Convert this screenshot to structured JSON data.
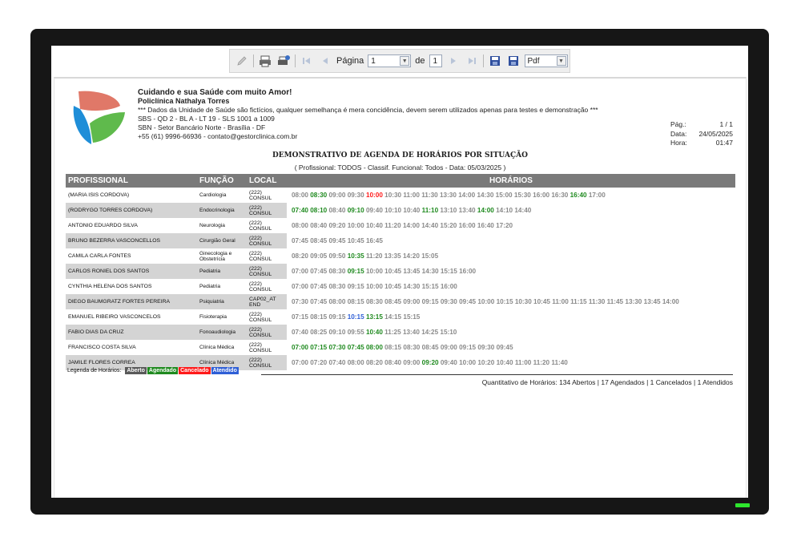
{
  "toolbar": {
    "page_label": "Página",
    "page_value": "1",
    "of_label": "de",
    "total_pages": "1",
    "format_value": "Pdf"
  },
  "header": {
    "slogan": "Cuidando e sua Saúde com muito Amor!",
    "clinic": "Policlínica Nathalya Torres",
    "disclaimer": "*** Dados da Unidade de Saúde são fictícios, qualquer semelhança é mera concidência, devem serem utilizados apenas para testes e demonstração ***",
    "address1": "SBS - QD 2 - BL A - LT 19 - SLS 1001 a 1009",
    "address2": "SBN - Setor Bancário Norte - Brasília - DF",
    "contact": "+55 (61) 9996-66936 - contato@gestorclinica.com.br"
  },
  "meta": {
    "page_label": "Pág.:",
    "page_value": "1 / 1",
    "date_label": "Data:",
    "date_value": "24/05/2025",
    "time_label": "Hora:",
    "time_value": "01:47"
  },
  "report": {
    "title": "DEMONSTRATIVO DE AGENDA DE HORÁRIOS POR SITUAÇÃO",
    "subtitle": "( Profissional: TODOS - Classif. Funcional: Todos - Data: 05/03/2025 )",
    "columns": [
      "PROFISSIONAL",
      "FUNÇÃO",
      "LOCAL",
      "HORÁRIOS"
    ],
    "rows": [
      {
        "name": "(MARIA ISIS CORDOVA)",
        "function": "Cardiologia",
        "local": "(222) CONSUL",
        "times": [
          [
            "08:00",
            "aberto"
          ],
          [
            "08:30",
            "agendado"
          ],
          [
            "09:00",
            "aberto"
          ],
          [
            "09:30",
            "aberto"
          ],
          [
            "10:00",
            "cancelado"
          ],
          [
            "10:30",
            "aberto"
          ],
          [
            "11:00",
            "aberto"
          ],
          [
            "11:30",
            "aberto"
          ],
          [
            "13:30",
            "aberto"
          ],
          [
            "14:00",
            "aberto"
          ],
          [
            "14:30",
            "aberto"
          ],
          [
            "15:00",
            "aberto"
          ],
          [
            "15:30",
            "aberto"
          ],
          [
            "16:00",
            "aberto"
          ],
          [
            "16:30",
            "aberto"
          ],
          [
            "16:40",
            "agendado"
          ],
          [
            "17:00",
            "aberto"
          ]
        ]
      },
      {
        "name": "(RODRYGO TORRES CORDOVA)",
        "function": "Endocrinologia",
        "local": "(222) CONSUL",
        "times": [
          [
            "07:40",
            "agendado"
          ],
          [
            "08:10",
            "agendado"
          ],
          [
            "08:40",
            "aberto"
          ],
          [
            "09:10",
            "agendado"
          ],
          [
            "09:40",
            "aberto"
          ],
          [
            "10:10",
            "aberto"
          ],
          [
            "10:40",
            "aberto"
          ],
          [
            "11:10",
            "agendado"
          ],
          [
            "13:10",
            "aberto"
          ],
          [
            "13:40",
            "aberto"
          ],
          [
            "14:00",
            "agendado"
          ],
          [
            "14:10",
            "aberto"
          ],
          [
            "14:40",
            "aberto"
          ]
        ]
      },
      {
        "name": "ANTONIO EDUARDO SILVA",
        "function": "Neurologia",
        "local": "(222) CONSUL",
        "times": [
          [
            "08:00",
            "aberto"
          ],
          [
            "08:40",
            "aberto"
          ],
          [
            "09:20",
            "aberto"
          ],
          [
            "10:00",
            "aberto"
          ],
          [
            "10:40",
            "aberto"
          ],
          [
            "11:20",
            "aberto"
          ],
          [
            "14:00",
            "aberto"
          ],
          [
            "14:40",
            "aberto"
          ],
          [
            "15:20",
            "aberto"
          ],
          [
            "16:00",
            "aberto"
          ],
          [
            "16:40",
            "aberto"
          ],
          [
            "17:20",
            "aberto"
          ]
        ]
      },
      {
        "name": "BRUNO BEZERRA VASCONCELLOS",
        "function": "Cirurgião Geral",
        "local": "(222) CONSUL",
        "times": [
          [
            "07:45",
            "aberto"
          ],
          [
            "08:45",
            "aberto"
          ],
          [
            "09:45",
            "aberto"
          ],
          [
            "10:45",
            "aberto"
          ],
          [
            "16:45",
            "aberto"
          ]
        ]
      },
      {
        "name": "CAMILA CARLA FONTES",
        "function": "Ginecologia e Obstetrícia",
        "local": "(222) CONSUL",
        "times": [
          [
            "08:20",
            "aberto"
          ],
          [
            "09:05",
            "aberto"
          ],
          [
            "09:50",
            "aberto"
          ],
          [
            "10:35",
            "agendado"
          ],
          [
            "11:20",
            "aberto"
          ],
          [
            "13:35",
            "aberto"
          ],
          [
            "14:20",
            "aberto"
          ],
          [
            "15:05",
            "aberto"
          ]
        ]
      },
      {
        "name": "CARLOS RONIEL DOS SANTOS",
        "function": "Pediatria",
        "local": "(222) CONSUL",
        "times": [
          [
            "07:00",
            "aberto"
          ],
          [
            "07:45",
            "aberto"
          ],
          [
            "08:30",
            "aberto"
          ],
          [
            "09:15",
            "agendado"
          ],
          [
            "10:00",
            "aberto"
          ],
          [
            "10:45",
            "aberto"
          ],
          [
            "13:45",
            "aberto"
          ],
          [
            "14:30",
            "aberto"
          ],
          [
            "15:15",
            "aberto"
          ],
          [
            "16:00",
            "aberto"
          ]
        ]
      },
      {
        "name": "CYNTHIA HELENA DOS SANTOS",
        "function": "Pediatria",
        "local": "(222) CONSUL",
        "times": [
          [
            "07:00",
            "aberto"
          ],
          [
            "07:45",
            "aberto"
          ],
          [
            "08:30",
            "aberto"
          ],
          [
            "09:15",
            "aberto"
          ],
          [
            "10:00",
            "aberto"
          ],
          [
            "10:45",
            "aberto"
          ],
          [
            "14:30",
            "aberto"
          ],
          [
            "15:15",
            "aberto"
          ],
          [
            "16:00",
            "aberto"
          ]
        ]
      },
      {
        "name": "DIEGO BAUMGRATZ FORTES PEREIRA",
        "function": "Psiquiatria",
        "local": "CAP02_AT END",
        "times": [
          [
            "07:30",
            "aberto"
          ],
          [
            "07:45",
            "aberto"
          ],
          [
            "08:00",
            "aberto"
          ],
          [
            "08:15",
            "aberto"
          ],
          [
            "08:30",
            "aberto"
          ],
          [
            "08:45",
            "aberto"
          ],
          [
            "09:00",
            "aberto"
          ],
          [
            "09:15",
            "aberto"
          ],
          [
            "09:30",
            "aberto"
          ],
          [
            "09:45",
            "aberto"
          ],
          [
            "10:00",
            "aberto"
          ],
          [
            "10:15",
            "aberto"
          ],
          [
            "10:30",
            "aberto"
          ],
          [
            "10:45",
            "aberto"
          ],
          [
            "11:00",
            "aberto"
          ],
          [
            "11:15",
            "aberto"
          ],
          [
            "11:30",
            "aberto"
          ],
          [
            "11:45",
            "aberto"
          ],
          [
            "13:30",
            "aberto"
          ],
          [
            "13:45",
            "aberto"
          ],
          [
            "14:00",
            "aberto"
          ]
        ]
      },
      {
        "name": "EMANUEL RIBEIRO VASCONCELOS",
        "function": "Fisioterapia",
        "local": "(222) CONSUL",
        "times": [
          [
            "07:15",
            "aberto"
          ],
          [
            "08:15",
            "aberto"
          ],
          [
            "09:15",
            "aberto"
          ],
          [
            "10:15",
            "atendido"
          ],
          [
            "13:15",
            "agendado"
          ],
          [
            "14:15",
            "aberto"
          ],
          [
            "15:15",
            "aberto"
          ]
        ]
      },
      {
        "name": "FABIO DIAS DA CRUZ",
        "function": "Fonoaudiologia",
        "local": "(222) CONSUL",
        "times": [
          [
            "07:40",
            "aberto"
          ],
          [
            "08:25",
            "aberto"
          ],
          [
            "09:10",
            "aberto"
          ],
          [
            "09:55",
            "aberto"
          ],
          [
            "10:40",
            "agendado"
          ],
          [
            "11:25",
            "aberto"
          ],
          [
            "13:40",
            "aberto"
          ],
          [
            "14:25",
            "aberto"
          ],
          [
            "15:10",
            "aberto"
          ]
        ]
      },
      {
        "name": "FRANCISCO COSTA SILVA",
        "function": "Clínica Médica",
        "local": "(222) CONSUL",
        "times": [
          [
            "07:00",
            "agendado"
          ],
          [
            "07:15",
            "agendado"
          ],
          [
            "07:30",
            "agendado"
          ],
          [
            "07:45",
            "agendado"
          ],
          [
            "08:00",
            "agendado"
          ],
          [
            "08:15",
            "aberto"
          ],
          [
            "08:30",
            "aberto"
          ],
          [
            "08:45",
            "aberto"
          ],
          [
            "09:00",
            "aberto"
          ],
          [
            "09:15",
            "aberto"
          ],
          [
            "09:30",
            "aberto"
          ],
          [
            "09:45",
            "aberto"
          ]
        ]
      },
      {
        "name": "JAMILE FLORES CORREA",
        "function": "Clínica Médica",
        "local": "(222) CONSUL",
        "times": [
          [
            "07:00",
            "aberto"
          ],
          [
            "07:20",
            "aberto"
          ],
          [
            "07:40",
            "aberto"
          ],
          [
            "08:00",
            "aberto"
          ],
          [
            "08:20",
            "aberto"
          ],
          [
            "08:40",
            "aberto"
          ],
          [
            "09:00",
            "aberto"
          ],
          [
            "09:20",
            "agendado"
          ],
          [
            "09:40",
            "aberto"
          ],
          [
            "10:00",
            "aberto"
          ],
          [
            "10:20",
            "aberto"
          ],
          [
            "10:40",
            "aberto"
          ],
          [
            "11:00",
            "aberto"
          ],
          [
            "11:20",
            "aberto"
          ],
          [
            "11:40",
            "aberto"
          ]
        ]
      }
    ]
  },
  "legend": {
    "label": "Legenda de Horários:",
    "aberto": "Aberto",
    "agendado": "Agendado",
    "cancelado": "Cancelado",
    "atendido": "Atendido",
    "colors": {
      "aberto": "#5a5a5a",
      "agendado": "#1f8a1f",
      "cancelado": "#ff1a1a",
      "atendido": "#2f5fd6"
    }
  },
  "summary": "Quantitativo de Horários: 134 Abertos | 17 Agendados | 1 Cancelados | 1 Atendidos"
}
